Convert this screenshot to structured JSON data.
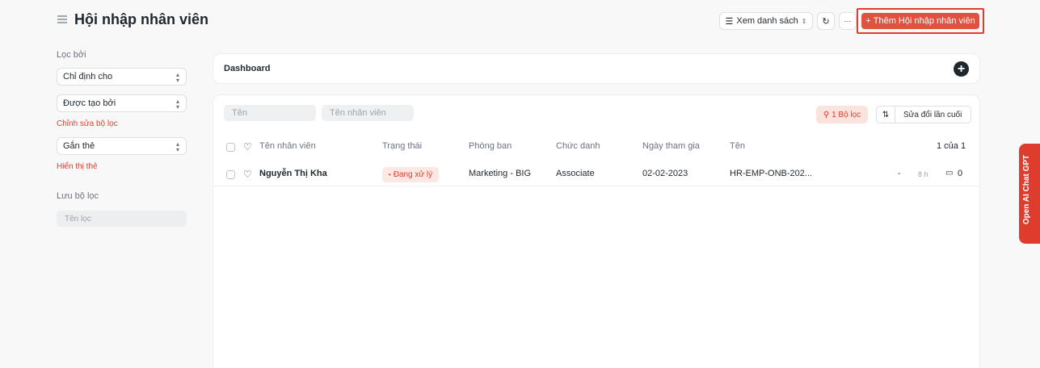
{
  "header": {
    "title": "Hội nhập nhân viên",
    "view_label": "Xem danh sách",
    "more_label": "···",
    "primary_label": "Thêm Hội nhập nhân viên",
    "accent": "#e0513f"
  },
  "sidebar": {
    "filter_by": "Lọc bởi",
    "assigned_to": "Chỉ định cho",
    "created_by": "Được tạo bởi",
    "edit_filters": "Chỉnh sửa bộ lọc",
    "tags": "Gắn thẻ",
    "show_tags": "Hiển thị thẻ",
    "save_filter": "Lưu bộ lọc",
    "filter_name_placeholder": "Tên lọc"
  },
  "dashboard": {
    "title": "Dashboard"
  },
  "list": {
    "filter_name_placeholder": "Tên",
    "filter_employee_placeholder": "Tên nhân viên",
    "filter_badge": "1 Bộ lọc",
    "sort_label": "Sửa đổi lần cuối",
    "columns": {
      "employee_name": "Tên nhân viên",
      "status": "Trạng thái",
      "department": "Phòng ban",
      "designation": "Chức danh",
      "joining_date": "Ngày tham gia",
      "name": "Tên",
      "count": "1 của 1"
    },
    "rows": [
      {
        "employee_name": "Nguyễn Thị Kha",
        "status": "Đang xử lý",
        "department": "Marketing - BIG",
        "designation": "Associate",
        "joining_date": "02-02-2023",
        "name": "HR-EMP-ONB-202...",
        "dash": "-",
        "modified": "8 h",
        "comments": "0"
      }
    ]
  },
  "ai_chat": {
    "label": "Open AI Chat GPT"
  }
}
